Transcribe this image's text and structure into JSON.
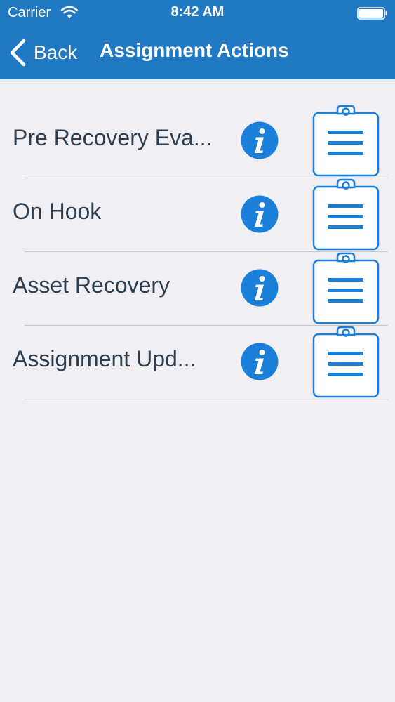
{
  "status_bar": {
    "carrier": "Carrier",
    "time": "8:42 AM"
  },
  "nav": {
    "back_label": "Back",
    "title": "Assignment Actions"
  },
  "actions": [
    {
      "label": "Pre Recovery Eva..."
    },
    {
      "label": "On Hook"
    },
    {
      "label": "Asset Recovery"
    },
    {
      "label": "Assignment Upd..."
    }
  ],
  "colors": {
    "header": "#2179c3",
    "accent": "#1a7fd8",
    "background": "#efeff4",
    "text": "#2c3e50"
  },
  "icons": {
    "info": "info-icon",
    "clipboard": "clipboard-list-icon",
    "back": "chevron-left-icon"
  }
}
